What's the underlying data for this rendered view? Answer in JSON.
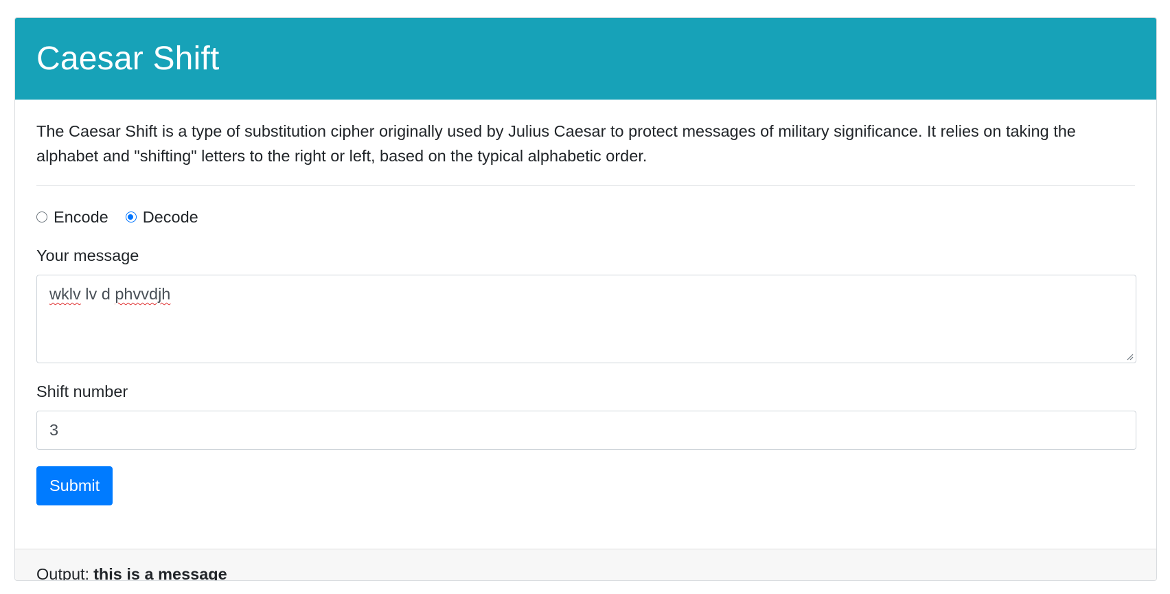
{
  "header": {
    "title": "Caesar Shift"
  },
  "intro": {
    "text": "The Caesar Shift is a type of substitution cipher originally used by Julius Caesar to protect messages of military significance. It relies on taking the alphabet and \"shifting\" letters to the right or left, based on the typical alphabetic order."
  },
  "mode": {
    "options": [
      {
        "label": "Encode",
        "checked": false
      },
      {
        "label": "Decode",
        "checked": true
      }
    ],
    "accent_color": "#0075ff"
  },
  "message": {
    "label": "Your message",
    "value_words": [
      "wklv",
      "lv",
      "d",
      "phvvdjh"
    ]
  },
  "shift": {
    "label": "Shift number",
    "value": "3"
  },
  "submit": {
    "label": "Submit",
    "color": "#007bff"
  },
  "output": {
    "label": "Output:",
    "value": "this is a message"
  },
  "colors": {
    "header_bg": "#17a2b8",
    "footer_bg": "#f7f7f7"
  }
}
